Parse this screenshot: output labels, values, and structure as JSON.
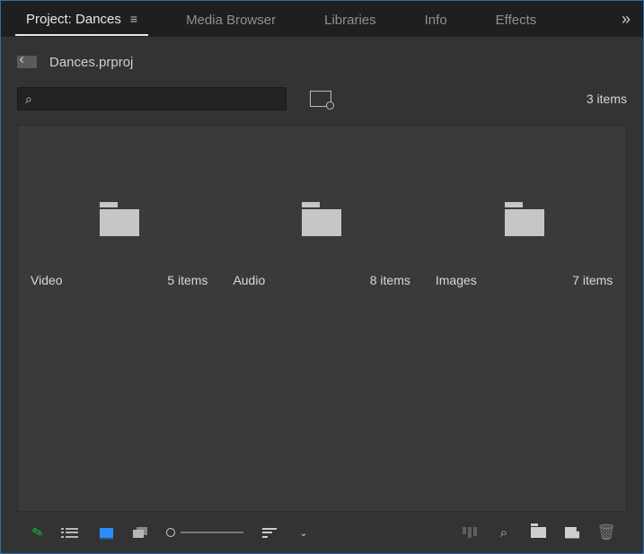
{
  "tabs": {
    "active": "Project: Dances",
    "t1": "Media Browser",
    "t2": "Libraries",
    "t3": "Info",
    "t4": "Effects"
  },
  "project": {
    "filename": "Dances.prproj"
  },
  "summary": {
    "count_label": "3 items"
  },
  "bins": [
    {
      "name": "Video",
      "count": "5 items"
    },
    {
      "name": "Audio",
      "count": "8 items"
    },
    {
      "name": "Images",
      "count": "7 items"
    }
  ],
  "icons": {
    "search": "⌕",
    "overflow": "»",
    "pencil": "✎",
    "trash": "🗑",
    "chev": "⌄",
    "hamburger": "≡"
  }
}
